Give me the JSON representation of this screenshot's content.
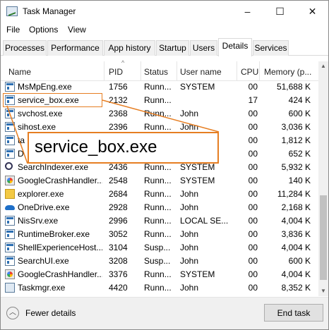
{
  "window": {
    "title": "Task Manager",
    "controls": [
      "–",
      "☐",
      "✕"
    ]
  },
  "menu": [
    "File",
    "Options",
    "View"
  ],
  "tabs": [
    {
      "label": "Processes"
    },
    {
      "label": "Performance"
    },
    {
      "label": "App history"
    },
    {
      "label": "Startup"
    },
    {
      "label": "Users"
    },
    {
      "label": "Details",
      "active": true
    },
    {
      "label": "Services"
    }
  ],
  "columns": {
    "name": "Name",
    "pid": "PID",
    "status": "Status",
    "user": "User name",
    "cpu": "CPU",
    "memory": "Memory (p..."
  },
  "rows": [
    {
      "icon": "window-icon",
      "name": "MsMpEng.exe",
      "pid": "1756",
      "status": "Runn...",
      "user": "SYSTEM",
      "cpu": "00",
      "memory": "51,688 K"
    },
    {
      "icon": "window-icon",
      "name": "service_box.exe",
      "pid": "2132",
      "status": "Runn...",
      "user": "",
      "cpu": "17",
      "memory": "424 K"
    },
    {
      "icon": "window-icon",
      "name": "svchost.exe",
      "pid": "2368",
      "status": "Runn...",
      "user": "John",
      "cpu": "00",
      "memory": "600 K"
    },
    {
      "icon": "window-icon",
      "name": "sihost.exe",
      "pid": "2396",
      "status": "Runn...",
      "user": "John",
      "cpu": "00",
      "memory": "3,036 K"
    },
    {
      "icon": "window-icon",
      "name": "ta",
      "pid": "",
      "status": "",
      "user": "",
      "cpu": "00",
      "memory": "1,812 K"
    },
    {
      "icon": "window-icon",
      "name": "D",
      "pid": "",
      "status": "",
      "user": "",
      "cpu": "00",
      "memory": "652 K"
    },
    {
      "icon": "search-icon",
      "name": "SearchIndexer.exe",
      "pid": "2436",
      "status": "Runn...",
      "user": "SYSTEM",
      "cpu": "00",
      "memory": "5,932 K"
    },
    {
      "icon": "google-crash-icon",
      "name": "GoogleCrashHandler...",
      "pid": "2548",
      "status": "Runn...",
      "user": "SYSTEM",
      "cpu": "00",
      "memory": "140 K"
    },
    {
      "icon": "explorer-icon",
      "name": "explorer.exe",
      "pid": "2684",
      "status": "Runn...",
      "user": "John",
      "cpu": "00",
      "memory": "11,284 K"
    },
    {
      "icon": "onedrive-icon",
      "name": "OneDrive.exe",
      "pid": "2928",
      "status": "Runn...",
      "user": "John",
      "cpu": "00",
      "memory": "2,168 K"
    },
    {
      "icon": "window-icon",
      "name": "NisSrv.exe",
      "pid": "2996",
      "status": "Runn...",
      "user": "LOCAL SE...",
      "cpu": "00",
      "memory": "4,004 K"
    },
    {
      "icon": "window-icon",
      "name": "RuntimeBroker.exe",
      "pid": "3052",
      "status": "Runn...",
      "user": "John",
      "cpu": "00",
      "memory": "3,836 K"
    },
    {
      "icon": "window-icon",
      "name": "ShellExperienceHost....",
      "pid": "3104",
      "status": "Susp...",
      "user": "John",
      "cpu": "00",
      "memory": "4,004 K"
    },
    {
      "icon": "window-icon",
      "name": "SearchUI.exe",
      "pid": "3208",
      "status": "Susp...",
      "user": "John",
      "cpu": "00",
      "memory": "600 K"
    },
    {
      "icon": "google-crash-icon",
      "name": "GoogleCrashHandler...",
      "pid": "3376",
      "status": "Runn...",
      "user": "SYSTEM",
      "cpu": "00",
      "memory": "4,004 K"
    },
    {
      "icon": "task-manager-icon",
      "name": "Taskmgr.exe",
      "pid": "4420",
      "status": "Runn...",
      "user": "John",
      "cpu": "00",
      "memory": "8,352 K"
    }
  ],
  "footer": {
    "fewer_details": "Fewer details",
    "end_task": "End task"
  },
  "callout": {
    "text": "service_box.exe",
    "color": "#e67e22"
  }
}
